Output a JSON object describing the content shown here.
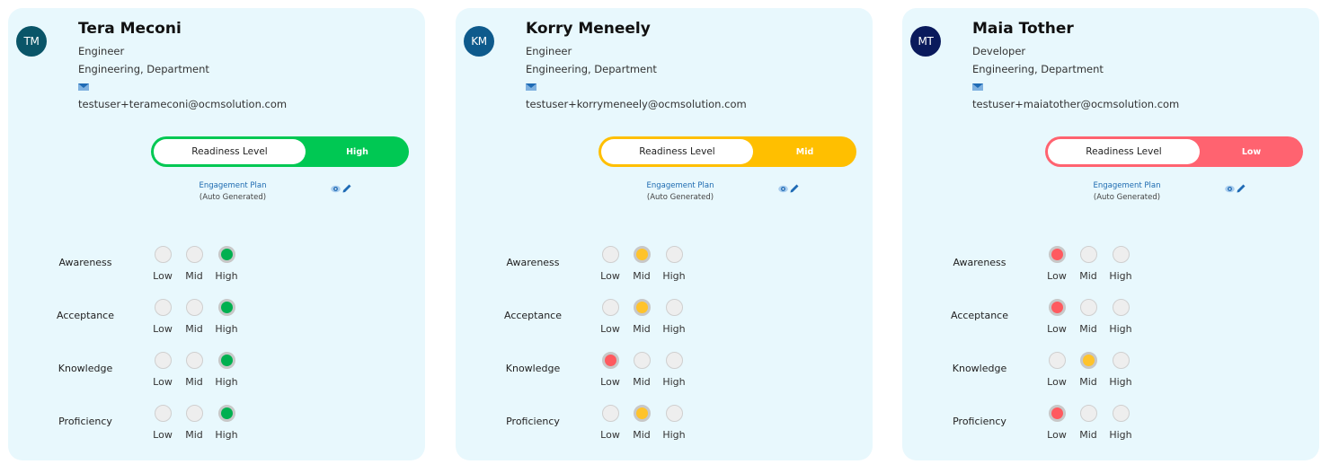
{
  "colors": {
    "high": "#00c853",
    "mid": "#ffbf00",
    "low": "#ff6370",
    "dot_high": "#00b050",
    "dot_mid": "#ffc32b",
    "dot_low": "#ff5a5f",
    "link": "#1c6ab0"
  },
  "labels": {
    "readiness": "Readiness Level",
    "plan_link": "Engagement Plan",
    "plan_sub": "(Auto Generated)",
    "levels": [
      "Low",
      "Mid",
      "High"
    ],
    "metrics": [
      "Awareness",
      "Acceptance",
      "Knowledge",
      "Proficiency"
    ]
  },
  "cards": [
    {
      "initials": "TM",
      "avatar_color": "#0a5568",
      "name": "Tera Meconi",
      "role": "Engineer",
      "department": "Engineering, Department",
      "email": "testuser+terameconi@ocmsolution.com",
      "readiness": "High",
      "metrics": [
        "High",
        "High",
        "High",
        "High"
      ]
    },
    {
      "initials": "KM",
      "avatar_color": "#0e5a8c",
      "name": "Korry Meneely",
      "role": "Engineer",
      "department": "Engineering, Department",
      "email": "testuser+korrymeneely@ocmsolution.com",
      "readiness": "Mid",
      "metrics": [
        "Mid",
        "Mid",
        "Low",
        "Mid"
      ]
    },
    {
      "initials": "MT",
      "avatar_color": "#0a1a5c",
      "name": "Maia Tother",
      "role": "Developer",
      "department": "Engineering, Department",
      "email": "testuser+maiatother@ocmsolution.com",
      "readiness": "Low",
      "metrics": [
        "Low",
        "Low",
        "Mid",
        "Low"
      ]
    }
  ]
}
